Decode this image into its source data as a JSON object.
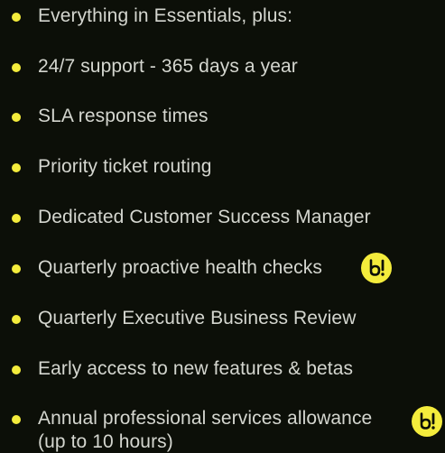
{
  "colors": {
    "background": "#0c0f08",
    "text": "#d4d6cf",
    "accent": "#f4ec3c",
    "badge_glyph": "#0c0f08"
  },
  "features": [
    {
      "label": "Everything in Essentials, plus:"
    },
    {
      "label": "24/7 support - 365 days a year"
    },
    {
      "label": "SLA response times"
    },
    {
      "label": "Priority ticket routing"
    },
    {
      "label": "Dedicated Customer Success Manager"
    },
    {
      "label": "Quarterly proactive health checks",
      "badge_icon": "brand-logo-b-exclaim-icon"
    },
    {
      "label": "Quarterly Executive Business Review"
    },
    {
      "label": "Early access to new features & betas"
    },
    {
      "label": "Annual professional services allowance",
      "label_line2": "(up to 10 hours)",
      "badge_icon": "brand-logo-b-exclaim-icon"
    }
  ]
}
